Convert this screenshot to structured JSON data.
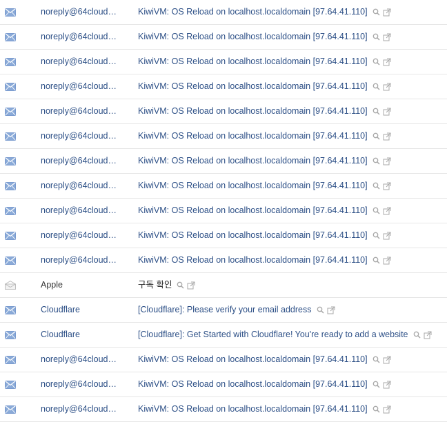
{
  "colors": {
    "unread_text": "#2c4f86",
    "read_text": "#222222",
    "envelope_unread": "#8aaad8",
    "envelope_read": "#bdbdbd",
    "divider": "#e6e6e6"
  },
  "icons": {
    "unread": "envelope-closed-icon",
    "read": "envelope-open-icon",
    "search": "magnifier-icon",
    "popup": "open-new-window-icon"
  },
  "mail_list": [
    {
      "sender": "noreply@64cloud…",
      "subject": "KiwiVM: OS Reload on localhost.localdomain [97.64.41.110]",
      "read": false
    },
    {
      "sender": "noreply@64cloud…",
      "subject": "KiwiVM: OS Reload on localhost.localdomain [97.64.41.110]",
      "read": false
    },
    {
      "sender": "noreply@64cloud…",
      "subject": "KiwiVM: OS Reload on localhost.localdomain [97.64.41.110]",
      "read": false
    },
    {
      "sender": "noreply@64cloud…",
      "subject": "KiwiVM: OS Reload on localhost.localdomain [97.64.41.110]",
      "read": false
    },
    {
      "sender": "noreply@64cloud…",
      "subject": "KiwiVM: OS Reload on localhost.localdomain [97.64.41.110]",
      "read": false
    },
    {
      "sender": "noreply@64cloud…",
      "subject": "KiwiVM: OS Reload on localhost.localdomain [97.64.41.110]",
      "read": false
    },
    {
      "sender": "noreply@64cloud…",
      "subject": "KiwiVM: OS Reload on localhost.localdomain [97.64.41.110]",
      "read": false
    },
    {
      "sender": "noreply@64cloud…",
      "subject": "KiwiVM: OS Reload on localhost.localdomain [97.64.41.110]",
      "read": false
    },
    {
      "sender": "noreply@64cloud…",
      "subject": "KiwiVM: OS Reload on localhost.localdomain [97.64.41.110]",
      "read": false
    },
    {
      "sender": "noreply@64cloud…",
      "subject": "KiwiVM: OS Reload on localhost.localdomain [97.64.41.110]",
      "read": false
    },
    {
      "sender": "noreply@64cloud…",
      "subject": "KiwiVM: OS Reload on localhost.localdomain [97.64.41.110]",
      "read": false
    },
    {
      "sender": "Apple",
      "subject": "구독 확인",
      "read": true
    },
    {
      "sender": "Cloudflare",
      "subject": "[Cloudflare]: Please verify your email address",
      "read": false
    },
    {
      "sender": "Cloudflare",
      "subject": "[Cloudflare]: Get Started with Cloudflare! You're ready to add a website",
      "read": false
    },
    {
      "sender": "noreply@64cloud…",
      "subject": "KiwiVM: OS Reload on localhost.localdomain [97.64.41.110]",
      "read": false
    },
    {
      "sender": "noreply@64cloud…",
      "subject": "KiwiVM: OS Reload on localhost.localdomain [97.64.41.110]",
      "read": false
    },
    {
      "sender": "noreply@64cloud…",
      "subject": "KiwiVM: OS Reload on localhost.localdomain [97.64.41.110]",
      "read": false
    }
  ]
}
